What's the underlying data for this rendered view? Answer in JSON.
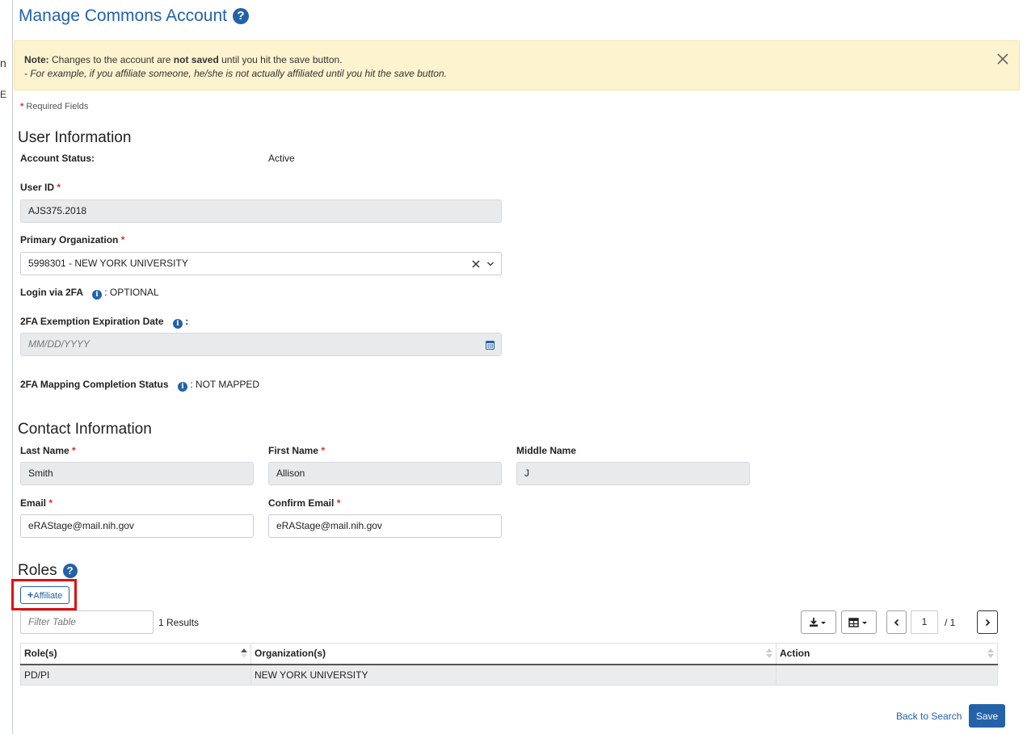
{
  "page": {
    "title": "Manage Commons Account",
    "left_fragments": [
      "n",
      "E"
    ]
  },
  "note": {
    "label": "Note:",
    "text_before": " Changes to the account are ",
    "emphasis": "not saved",
    "text_after": " until you hit the save button.",
    "example": "- For example, if you affiliate someone, he/she is not actually affiliated until you hit the save button."
  },
  "required": {
    "mark": "*",
    "text": "Required Fields"
  },
  "user_info": {
    "heading": "User Information",
    "account_status_label": "Account Status:",
    "account_status_value": "Active",
    "user_id_label": "User ID",
    "user_id_value": "AJS375.2018",
    "primary_org_label": "Primary Organization",
    "primary_org_value": "5998301 - NEW YORK UNIVERSITY",
    "login_2fa_label": "Login via 2FA",
    "login_2fa_value": ": OPTIONAL",
    "exemption_label": "2FA Exemption Expiration Date",
    "exemption_colon": ":",
    "exemption_placeholder": "MM/DD/YYYY",
    "mapping_label": "2FA Mapping Completion Status",
    "mapping_value": ": NOT MAPPED"
  },
  "contact": {
    "heading": "Contact Information",
    "last_name_label": "Last Name",
    "last_name_value": "Smith",
    "first_name_label": "First Name",
    "first_name_value": "Allison",
    "middle_name_label": "Middle Name",
    "middle_name_value": "J",
    "email_label": "Email",
    "email_value": "eRAStage@mail.nih.gov",
    "confirm_email_label": "Confirm Email",
    "confirm_email_value": "eRAStage@mail.nih.gov"
  },
  "roles": {
    "heading": "Roles",
    "affiliate_label": "Affiliate",
    "filter_placeholder": "Filter Table",
    "results_text": "1 Results",
    "page_current": "1",
    "page_total": "/ 1",
    "columns": [
      "Role(s)",
      "Organization(s)",
      "Action"
    ],
    "rows": [
      {
        "role": "PD/PI",
        "organization": "NEW YORK UNIVERSITY",
        "action": ""
      }
    ]
  },
  "footer": {
    "back_label": "Back to Search",
    "save_label": "Save"
  },
  "colors": {
    "accent": "#2362a8",
    "required": "#d9302a",
    "note_bg": "#fdf3cf",
    "highlight": "#e01010"
  },
  "icons": [
    "help-icon",
    "close-icon",
    "clear-icon",
    "chevron-down-icon",
    "info-icon",
    "calendar-icon",
    "plus-icon",
    "download-icon",
    "table-columns-icon",
    "chevron-left-icon",
    "chevron-right-icon",
    "sort-icon"
  ]
}
